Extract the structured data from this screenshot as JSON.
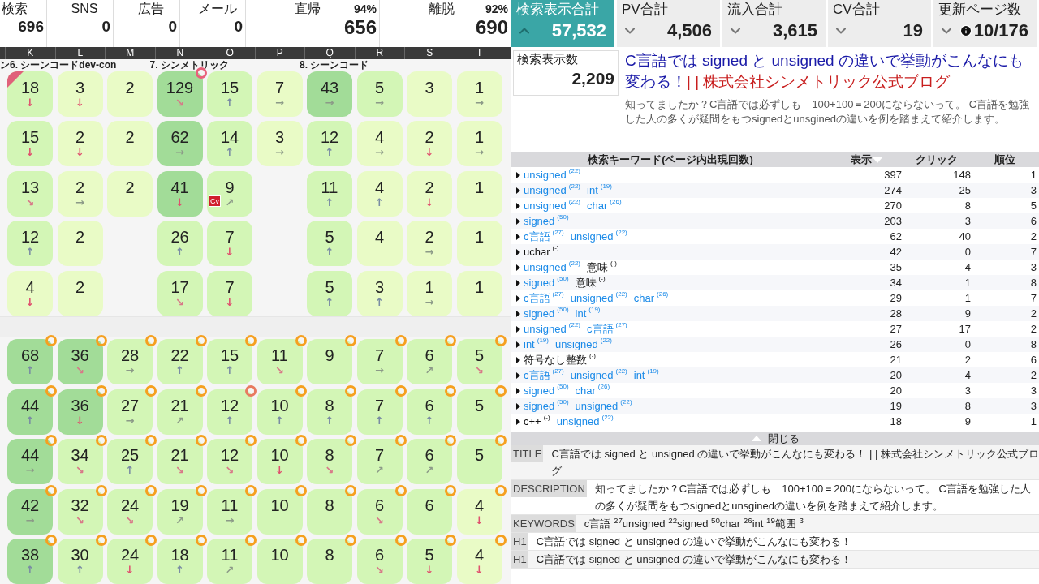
{
  "left_stats": [
    {
      "label": "検索",
      "value": "696"
    },
    {
      "label": "SNS",
      "value": "0"
    },
    {
      "label": "広告",
      "value": "0"
    },
    {
      "label": "メール",
      "value": "0"
    },
    {
      "label": "直帰",
      "percent": "94%",
      "value": "656"
    },
    {
      "label": "離脱",
      "percent": "92%",
      "value": "690"
    }
  ],
  "metrics": [
    {
      "label": "検索表示合計",
      "value": "57,532",
      "selected": true,
      "kind": "metric"
    },
    {
      "label": "PV合計",
      "value": "4,506",
      "selected": false,
      "kind": "metric"
    },
    {
      "label": "流入合計",
      "value": "3,615",
      "selected": false,
      "kind": "metric"
    },
    {
      "label": "CV合計",
      "value": "19",
      "selected": false,
      "kind": "metric"
    },
    {
      "label": "更新ページ数",
      "value": "10/176",
      "selected": false,
      "kind": "pages"
    }
  ],
  "columns": [
    {
      "letter": "K",
      "group": "ン6. シーンコードdev-con"
    },
    {
      "letter": "L"
    },
    {
      "letter": "M"
    },
    {
      "letter": "N",
      "group": "7. シンメトリック"
    },
    {
      "letter": "O"
    },
    {
      "letter": "P"
    },
    {
      "letter": "Q",
      "group": "8. シーンコード"
    },
    {
      "letter": "R"
    },
    {
      "letter": "S"
    },
    {
      "letter": "T"
    }
  ],
  "grid_top": [
    [
      {
        "kind": "tile",
        "value": "18",
        "arrow": "↓",
        "color": "#d3f6b6",
        "corner": {
          "color": "#e0607a"
        }
      },
      {
        "kind": "tile",
        "value": "3",
        "arrow": "↓",
        "color": "#e9fbc6"
      },
      {
        "kind": "tile",
        "value": "2",
        "color": "#e9fbc6"
      },
      {
        "kind": "tile",
        "value": "129",
        "arrow": "↘",
        "color": "#a2dc98",
        "ring": {
          "color": "#e8607a"
        }
      },
      {
        "kind": "tile",
        "value": "15",
        "arrow": "↑",
        "color": "#d3f6b6"
      },
      {
        "kind": "tile",
        "value": "7",
        "arrow": "→",
        "color": "#e9fbc6"
      },
      {
        "kind": "tile",
        "value": "43",
        "arrow": "→",
        "color": "#a2dc98"
      },
      {
        "kind": "tile",
        "value": "5",
        "arrow": "→",
        "color": "#d3f6b6"
      },
      {
        "kind": "tile",
        "value": "3",
        "color": "#e9fbc6"
      },
      {
        "kind": "tile",
        "value": "1",
        "arrow": "→",
        "color": "#e9fbc6"
      }
    ],
    [
      {
        "kind": "tile",
        "value": "15",
        "arrow": "↓",
        "color": "#d3f6b6"
      },
      {
        "kind": "tile",
        "value": "2",
        "arrow": "↓",
        "color": "#e9fbc6"
      },
      {
        "kind": "tile",
        "value": "2",
        "color": "#e9fbc6"
      },
      {
        "kind": "tile",
        "value": "62",
        "arrow": "→",
        "color": "#a2dc98"
      },
      {
        "kind": "tile",
        "value": "14",
        "arrow": "↑",
        "color": "#d3f6b6"
      },
      {
        "kind": "tile",
        "value": "3",
        "arrow": "→",
        "color": "#e9fbc6"
      },
      {
        "kind": "tile",
        "value": "12",
        "arrow": "↑",
        "color": "#d3f6b6"
      },
      {
        "kind": "tile",
        "value": "4",
        "arrow": "→",
        "color": "#e9fbc6"
      },
      {
        "kind": "tile",
        "value": "2",
        "arrow": "↓",
        "color": "#e9fbc6"
      },
      {
        "kind": "tile",
        "value": "1",
        "arrow": "→",
        "color": "#e9fbc6"
      }
    ],
    [
      {
        "kind": "tile",
        "value": "13",
        "arrow": "↘",
        "color": "#d3f6b6"
      },
      {
        "kind": "tile",
        "value": "2",
        "arrow": "→",
        "color": "#e9fbc6"
      },
      {
        "kind": "tile",
        "value": "2",
        "color": "#e9fbc6"
      },
      {
        "kind": "tile",
        "value": "41",
        "arrow": "↓",
        "color": "#a2dc98"
      },
      {
        "kind": "tile",
        "value": "9",
        "arrow": "↗",
        "color": "#d3f6b6",
        "tag": "Cv"
      },
      {
        "kind": "empty"
      },
      {
        "kind": "tile",
        "value": "11",
        "arrow": "↑",
        "color": "#d3f6b6"
      },
      {
        "kind": "tile",
        "value": "4",
        "arrow": "↑",
        "color": "#e9fbc6"
      },
      {
        "kind": "tile",
        "value": "2",
        "arrow": "↓",
        "color": "#e9fbc6"
      },
      {
        "kind": "tile",
        "value": "1",
        "color": "#e9fbc6"
      }
    ],
    [
      {
        "kind": "tile",
        "value": "12",
        "arrow": "↑",
        "color": "#d3f6b6"
      },
      {
        "kind": "tile",
        "value": "2",
        "color": "#e9fbc6"
      },
      {
        "kind": "empty"
      },
      {
        "kind": "tile",
        "value": "26",
        "arrow": "↑",
        "color": "#d3f6b6"
      },
      {
        "kind": "tile",
        "value": "7",
        "arrow": "↓",
        "color": "#d3f6b6"
      },
      {
        "kind": "empty"
      },
      {
        "kind": "tile",
        "value": "5",
        "arrow": "↑",
        "color": "#d3f6b6"
      },
      {
        "kind": "tile",
        "value": "4",
        "color": "#e9fbc6"
      },
      {
        "kind": "tile",
        "value": "2",
        "arrow": "→",
        "color": "#e9fbc6"
      },
      {
        "kind": "tile",
        "value": "1",
        "color": "#e9fbc6"
      }
    ],
    [
      {
        "kind": "tile",
        "value": "4",
        "arrow": "↓",
        "color": "#e9fbc6"
      },
      {
        "kind": "tile",
        "value": "2",
        "color": "#e9fbc6"
      },
      {
        "kind": "empty"
      },
      {
        "kind": "tile",
        "value": "17",
        "arrow": "↘",
        "color": "#d3f6b6"
      },
      {
        "kind": "tile",
        "value": "7",
        "arrow": "↓",
        "color": "#d3f6b6"
      },
      {
        "kind": "empty"
      },
      {
        "kind": "tile",
        "value": "5",
        "arrow": "↑",
        "color": "#d3f6b6"
      },
      {
        "kind": "tile",
        "value": "3",
        "arrow": "↑",
        "color": "#e9fbc6"
      },
      {
        "kind": "tile",
        "value": "1",
        "arrow": "→",
        "color": "#e9fbc6"
      },
      {
        "kind": "tile",
        "value": "1",
        "color": "#e9fbc6"
      }
    ]
  ],
  "grid_bottom": [
    [
      {
        "kind": "tile",
        "value": "68",
        "arrow": "↑",
        "color": "#a2dc98",
        "ring": {
          "color": "#f5a020"
        }
      },
      {
        "kind": "tile",
        "value": "36",
        "arrow": "↘",
        "color": "#a2dc98",
        "ring": {
          "color": "#f5a020"
        }
      },
      {
        "kind": "tile",
        "value": "28",
        "arrow": "→",
        "color": "#d3f6b6",
        "ring": {
          "color": "#f5a020"
        }
      },
      {
        "kind": "tile",
        "value": "22",
        "arrow": "↑",
        "color": "#d3f6b6",
        "ring": {
          "color": "#f5a020"
        }
      },
      {
        "kind": "tile",
        "value": "15",
        "arrow": "↑",
        "color": "#d3f6b6",
        "ring": {
          "color": "#f5a020"
        }
      },
      {
        "kind": "tile",
        "value": "11",
        "arrow": "↘",
        "color": "#d3f6b6",
        "ring": {
          "color": "#f5a020"
        }
      },
      {
        "kind": "tile",
        "value": "9",
        "color": "#d3f6b6",
        "ring": {
          "color": "#f5a020"
        }
      },
      {
        "kind": "tile",
        "value": "7",
        "arrow": "→",
        "color": "#d3f6b6",
        "ring": {
          "color": "#f5a020"
        }
      },
      {
        "kind": "tile",
        "value": "6",
        "arrow": "↗",
        "color": "#d3f6b6",
        "ring": {
          "color": "#f5a020"
        }
      },
      {
        "kind": "tile",
        "value": "5",
        "arrow": "↘",
        "color": "#d3f6b6",
        "ring": {
          "color": "#f5a020"
        }
      }
    ],
    [
      {
        "kind": "tile",
        "value": "44",
        "arrow": "↑",
        "color": "#a2dc98",
        "ring": {
          "color": "#f5a020"
        }
      },
      {
        "kind": "tile",
        "value": "36",
        "arrow": "↓",
        "color": "#a2dc98",
        "ring": {
          "color": "#f5a020"
        }
      },
      {
        "kind": "tile",
        "value": "27",
        "arrow": "→",
        "color": "#d3f6b6",
        "ring": {
          "color": "#f5a020"
        }
      },
      {
        "kind": "tile",
        "value": "21",
        "arrow": "↗",
        "color": "#d3f6b6",
        "ring": {
          "color": "#f5a020"
        }
      },
      {
        "kind": "tile",
        "value": "12",
        "arrow": "↑",
        "color": "#d3f6b6",
        "ring": {
          "color": "#e87a60"
        }
      },
      {
        "kind": "tile",
        "value": "10",
        "arrow": "↑",
        "color": "#d3f6b6",
        "ring": {
          "color": "#f5a020"
        }
      },
      {
        "kind": "tile",
        "value": "8",
        "arrow": "↑",
        "color": "#d3f6b6",
        "ring": {
          "color": "#f5a020"
        }
      },
      {
        "kind": "tile",
        "value": "7",
        "arrow": "↑",
        "color": "#d3f6b6",
        "ring": {
          "color": "#f5a020"
        }
      },
      {
        "kind": "tile",
        "value": "6",
        "arrow": "↑",
        "color": "#d3f6b6",
        "ring": {
          "color": "#f5a020"
        }
      },
      {
        "kind": "tile",
        "value": "5",
        "color": "#d3f6b6",
        "ring": {
          "color": "#f5a020"
        }
      }
    ],
    [
      {
        "kind": "tile",
        "value": "44",
        "arrow": "→",
        "color": "#a2dc98",
        "ring": {
          "color": "#f5a020"
        }
      },
      {
        "kind": "tile",
        "value": "34",
        "arrow": "↘",
        "color": "#d3f6b6",
        "ring": {
          "color": "#f5a020"
        }
      },
      {
        "kind": "tile",
        "value": "25",
        "arrow": "↑",
        "color": "#d3f6b6",
        "ring": {
          "color": "#f5a020"
        }
      },
      {
        "kind": "tile",
        "value": "21",
        "arrow": "↘",
        "color": "#d3f6b6",
        "ring": {
          "color": "#f5a020"
        }
      },
      {
        "kind": "tile",
        "value": "12",
        "arrow": "↘",
        "color": "#d3f6b6",
        "ring": {
          "color": "#f5a020"
        }
      },
      {
        "kind": "tile",
        "value": "10",
        "arrow": "↓",
        "color": "#d3f6b6",
        "ring": {
          "color": "#f5a020"
        }
      },
      {
        "kind": "tile",
        "value": "8",
        "arrow": "↘",
        "color": "#d3f6b6",
        "ring": {
          "color": "#f5a020"
        }
      },
      {
        "kind": "tile",
        "value": "7",
        "arrow": "↗",
        "color": "#d3f6b6",
        "ring": {
          "color": "#f5a020"
        }
      },
      {
        "kind": "tile",
        "value": "6",
        "arrow": "↗",
        "color": "#d3f6b6",
        "ring": {
          "color": "#f5a020"
        }
      },
      {
        "kind": "tile",
        "value": "5",
        "color": "#d3f6b6",
        "ring": {
          "color": "#f5a020"
        }
      }
    ],
    [
      {
        "kind": "tile",
        "value": "42",
        "arrow": "→",
        "color": "#a2dc98",
        "ring": {
          "color": "#f5a020"
        }
      },
      {
        "kind": "tile",
        "value": "32",
        "arrow": "↘",
        "color": "#d3f6b6",
        "ring": {
          "color": "#f5a020"
        }
      },
      {
        "kind": "tile",
        "value": "24",
        "arrow": "↘",
        "color": "#d3f6b6",
        "ring": {
          "color": "#f5a020"
        }
      },
      {
        "kind": "tile",
        "value": "19",
        "arrow": "↗",
        "color": "#d3f6b6",
        "ring": {
          "color": "#f5a020"
        }
      },
      {
        "kind": "tile",
        "value": "11",
        "arrow": "→",
        "color": "#d3f6b6",
        "ring": {
          "color": "#f5a020"
        }
      },
      {
        "kind": "tile",
        "value": "10",
        "color": "#d3f6b6",
        "ring": {
          "color": "#f5a020"
        }
      },
      {
        "kind": "tile",
        "value": "8",
        "color": "#d3f6b6",
        "ring": {
          "color": "#f5a020"
        }
      },
      {
        "kind": "tile",
        "value": "6",
        "arrow": "↘",
        "color": "#d3f6b6",
        "ring": {
          "color": "#f5a020"
        }
      },
      {
        "kind": "tile",
        "value": "6",
        "color": "#d3f6b6",
        "ring": {
          "color": "#f5a020"
        }
      },
      {
        "kind": "tile",
        "value": "4",
        "arrow": "↓",
        "color": "#e9fbc6",
        "ring": {
          "color": "#f5a020"
        }
      }
    ],
    [
      {
        "kind": "tile",
        "value": "38",
        "arrow": "↑",
        "color": "#a2dc98",
        "ring": {
          "color": "#f5a020"
        }
      },
      {
        "kind": "tile",
        "value": "30",
        "arrow": "↑",
        "color": "#d3f6b6",
        "ring": {
          "color": "#f5a020"
        }
      },
      {
        "kind": "tile",
        "value": "24",
        "arrow": "↓",
        "color": "#d3f6b6",
        "ring": {
          "color": "#f5a020"
        }
      },
      {
        "kind": "tile",
        "value": "18",
        "arrow": "↑",
        "color": "#d3f6b6",
        "ring": {
          "color": "#f5a020"
        }
      },
      {
        "kind": "tile",
        "value": "11",
        "arrow": "↗",
        "color": "#d3f6b6",
        "ring": {
          "color": "#f5a020"
        }
      },
      {
        "kind": "tile",
        "value": "10",
        "color": "#d3f6b6",
        "ring": {
          "color": "#f5a020"
        }
      },
      {
        "kind": "tile",
        "value": "8",
        "color": "#d3f6b6",
        "ring": {
          "color": "#f5a020"
        }
      },
      {
        "kind": "tile",
        "value": "6",
        "arrow": "↘",
        "color": "#d3f6b6",
        "ring": {
          "color": "#f5a020"
        }
      },
      {
        "kind": "tile",
        "value": "5",
        "arrow": "↓",
        "color": "#d3f6b6",
        "ring": {
          "color": "#f5a020"
        }
      },
      {
        "kind": "tile",
        "value": "4",
        "arrow": "↓",
        "color": "#e9fbc6",
        "ring": {
          "color": "#f5a020"
        }
      }
    ]
  ],
  "page": {
    "impressions_label": "検索表示数",
    "impressions": "2,209",
    "title": "C言語では signed と unsigned の違いで挙動がこんなにも変わる！",
    "site": "| | 株式会社シンメトリック公式ブログ",
    "description": "知ってましたか？C言語では必ずしも　100+100＝200にならないって。 C言語を勉強した人の多くが疑問をもつsignedとunsginedの違いを例を踏まえて紹介します。"
  },
  "keyword_table": {
    "columns": [
      {
        "label": "検索キーワード(ページ内出現回数)",
        "sorted": false
      },
      {
        "label": "表示",
        "sorted": true
      },
      {
        "label": "クリック",
        "sorted": false
      },
      {
        "label": "順位",
        "sorted": false
      }
    ],
    "rows": [
      {
        "terms": [
          {
            "text": "unsigned",
            "count": "(22)",
            "kind": "link"
          }
        ],
        "impressions": "397",
        "clicks": "148",
        "rank": "1"
      },
      {
        "terms": [
          {
            "text": "unsigned",
            "count": "(22)",
            "kind": "link"
          },
          {
            "text": "int",
            "count": "(19)",
            "kind": "link"
          }
        ],
        "impressions": "274",
        "clicks": "25",
        "rank": "3"
      },
      {
        "terms": [
          {
            "text": "unsigned",
            "count": "(22)",
            "kind": "link"
          },
          {
            "text": "char",
            "count": "(26)",
            "kind": "link"
          }
        ],
        "impressions": "270",
        "clicks": "8",
        "rank": "5"
      },
      {
        "terms": [
          {
            "text": "signed",
            "count": "(50)",
            "kind": "link"
          }
        ],
        "impressions": "203",
        "clicks": "3",
        "rank": "6"
      },
      {
        "terms": [
          {
            "text": "c言語",
            "count": "(27)",
            "kind": "link"
          },
          {
            "text": "unsigned",
            "count": "(22)",
            "kind": "link"
          }
        ],
        "impressions": "62",
        "clicks": "40",
        "rank": "2"
      },
      {
        "terms": [
          {
            "text": "uchar",
            "count": "(-)",
            "kind": "plain"
          }
        ],
        "impressions": "42",
        "clicks": "0",
        "rank": "7"
      },
      {
        "terms": [
          {
            "text": "unsigned",
            "count": "(22)",
            "kind": "link"
          },
          {
            "text": "意味",
            "count": "(-)",
            "kind": "plain"
          }
        ],
        "impressions": "35",
        "clicks": "4",
        "rank": "3"
      },
      {
        "terms": [
          {
            "text": "signed",
            "count": "(50)",
            "kind": "link"
          },
          {
            "text": "意味",
            "count": "(-)",
            "kind": "plain"
          }
        ],
        "impressions": "34",
        "clicks": "1",
        "rank": "8"
      },
      {
        "terms": [
          {
            "text": "c言語",
            "count": "(27)",
            "kind": "link"
          },
          {
            "text": "unsigned",
            "count": "(22)",
            "kind": "link"
          },
          {
            "text": "char",
            "count": "(26)",
            "kind": "link"
          }
        ],
        "impressions": "29",
        "clicks": "1",
        "rank": "7"
      },
      {
        "terms": [
          {
            "text": "signed",
            "count": "(50)",
            "kind": "link"
          },
          {
            "text": "int",
            "count": "(19)",
            "kind": "link"
          }
        ],
        "impressions": "28",
        "clicks": "9",
        "rank": "2"
      },
      {
        "terms": [
          {
            "text": "unsigned",
            "count": "(22)",
            "kind": "link"
          },
          {
            "text": "c言語",
            "count": "(27)",
            "kind": "link"
          }
        ],
        "impressions": "27",
        "clicks": "17",
        "rank": "2"
      },
      {
        "terms": [
          {
            "text": "int",
            "count": "(19)",
            "kind": "link"
          },
          {
            "text": "unsigned",
            "count": "(22)",
            "kind": "link"
          }
        ],
        "impressions": "26",
        "clicks": "0",
        "rank": "8"
      },
      {
        "terms": [
          {
            "text": "符号なし整数",
            "count": "(-)",
            "kind": "plain"
          }
        ],
        "impressions": "21",
        "clicks": "2",
        "rank": "6"
      },
      {
        "terms": [
          {
            "text": "c言語",
            "count": "(27)",
            "kind": "link"
          },
          {
            "text": "unsigned",
            "count": "(22)",
            "kind": "link"
          },
          {
            "text": "int",
            "count": "(19)",
            "kind": "link"
          }
        ],
        "impressions": "20",
        "clicks": "4",
        "rank": "2"
      },
      {
        "terms": [
          {
            "text": "signed",
            "count": "(50)",
            "kind": "link"
          },
          {
            "text": "char",
            "count": "(26)",
            "kind": "link"
          }
        ],
        "impressions": "20",
        "clicks": "3",
        "rank": "3"
      },
      {
        "terms": [
          {
            "text": "signed",
            "count": "(50)",
            "kind": "link"
          },
          {
            "text": "unsigned",
            "count": "(22)",
            "kind": "link"
          }
        ],
        "impressions": "19",
        "clicks": "8",
        "rank": "3"
      },
      {
        "terms": [
          {
            "text": "c++",
            "count": "(-)",
            "kind": "plain"
          },
          {
            "text": "unsigned",
            "count": "(22)",
            "kind": "link"
          }
        ],
        "impressions": "18",
        "clicks": "9",
        "rank": "1"
      }
    ],
    "close_label": "閉じる"
  },
  "meta": [
    {
      "label": "TITLE",
      "text": "C言語では signed と unsigned の違いで挙動がこんなにも変わる！ | | 株式会社シンメトリック公式ブログ"
    },
    {
      "label": "DESCRIPTION",
      "text": "知ってましたか？C言語では必ずしも　100+100＝200にならないって。 C言語を勉強した人の多くが疑問をもつsignedとunsginedの違いを例を踏まえて紹介します。"
    },
    {
      "label": "KEYWORDS",
      "text": "c言語 $^{27}$unsigned $^{22}$signed $^{50}$char $^{26}$int $^{19}$範囲 $^{3}$"
    },
    {
      "label": "H1",
      "text": "C言語では signed と unsigned の違いで挙動がこんなにも変わる！"
    },
    {
      "label": "H1",
      "text": "C言語では signed と unsigned の違いで挙動がこんなにも変わる！"
    }
  ]
}
